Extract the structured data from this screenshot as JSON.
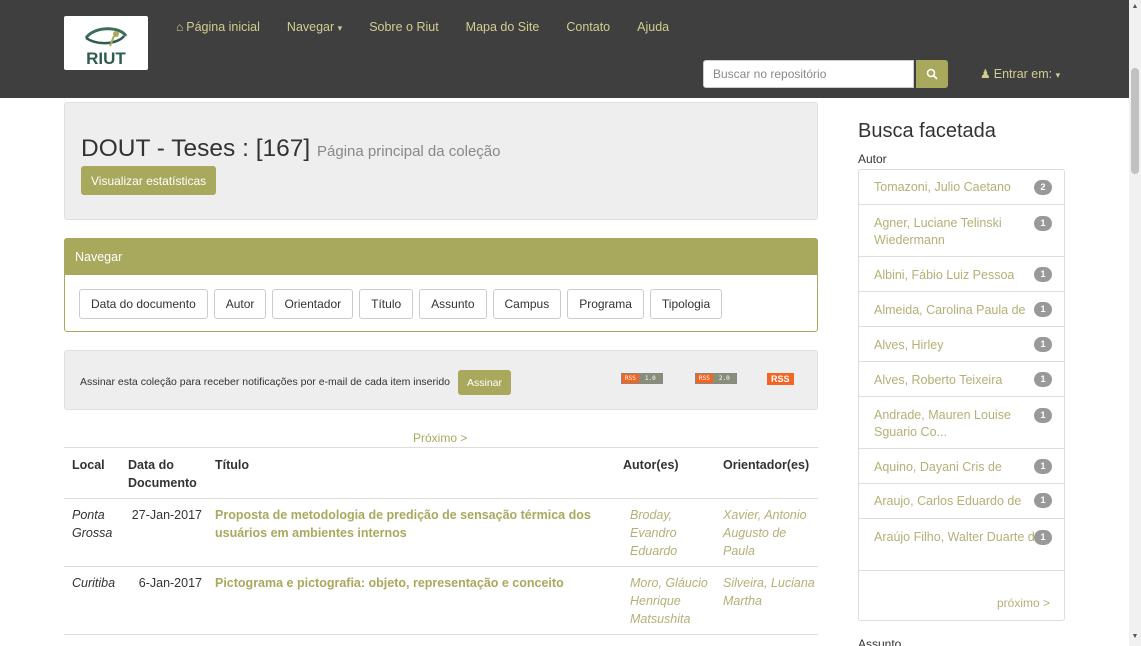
{
  "brand": {
    "logo_text": "RIUT",
    "accent": "#a9a95e",
    "navbar_bg": "#3f3f3f"
  },
  "nav": {
    "home": "Página inicial",
    "browse": "Navegar",
    "about": "Sobre o Riut",
    "sitemap": "Mapa do Site",
    "contact": "Contato",
    "help": "Ajuda",
    "search_placeholder": "Buscar no repositório",
    "login": "Entrar em:"
  },
  "collection": {
    "title": "DOUT - Teses : [167]",
    "subtitle": "Página principal da coleção",
    "stats_button": "Visualizar estatísticas"
  },
  "browse_panel": {
    "heading": "Navegar",
    "buttons": [
      "Data do documento",
      "Autor",
      "Orientador",
      "Título",
      "Assunto",
      "Campus",
      "Programa",
      "Tipologia"
    ]
  },
  "subscribe": {
    "text": "Assinar esta coleção para receber notificações por e-mail de cada item inserido",
    "button": "Assinar",
    "rss1_left": "RSS",
    "rss1_right": "1.0",
    "rss2_left": "RSS",
    "rss2_right": "2.0",
    "rss3": "RSS"
  },
  "results": {
    "next": "Próximo >",
    "headers": {
      "local": "Local",
      "date": "Data do Documento",
      "title": "Título",
      "authors": "Autor(es)",
      "advisors": "Orientador(es)"
    },
    "rows": [
      {
        "local": "Ponta Grossa",
        "date": "27-Jan-2017",
        "title": "Proposta de metodologia de predição de sensação térmica dos usuários em ambientes internos",
        "author": "Broday, Evandro Eduardo",
        "advisor": "Xavier, Antonio Augusto de Paula"
      },
      {
        "local": "Curitiba",
        "date": "6-Jan-2017",
        "title": "Pictograma e pictografia: objeto, representação e conceito",
        "author": "Moro, Gláucio Henrique Matsushita",
        "advisor": "Silveira, Luciana Martha"
      }
    ]
  },
  "sidebar": {
    "title": "Busca facetada",
    "author_label": "Autor",
    "facets": [
      {
        "name": "Tomazoni, Julio Caetano",
        "count": "2"
      },
      {
        "name": "Agner, Luciane Telinski Wiedermann",
        "count": "1"
      },
      {
        "name": "Albini, Fábio Luiz Pessoa",
        "count": "1"
      },
      {
        "name": "Almeida, Carolina Paula de",
        "count": "1"
      },
      {
        "name": "Alves, Hirley",
        "count": "1"
      },
      {
        "name": "Alves, Roberto Teixeira",
        "count": "1"
      },
      {
        "name": "Andrade, Mauren Louise Sguario Co...",
        "count": "1"
      },
      {
        "name": "Aquino, Dayani Cris de",
        "count": "1"
      },
      {
        "name": "Araujo, Carlos Eduardo de",
        "count": "1"
      },
      {
        "name": "Araújo Filho, Walter Duarte de",
        "count": "1"
      }
    ],
    "next": "próximo >",
    "subject_label": "Assunto"
  }
}
